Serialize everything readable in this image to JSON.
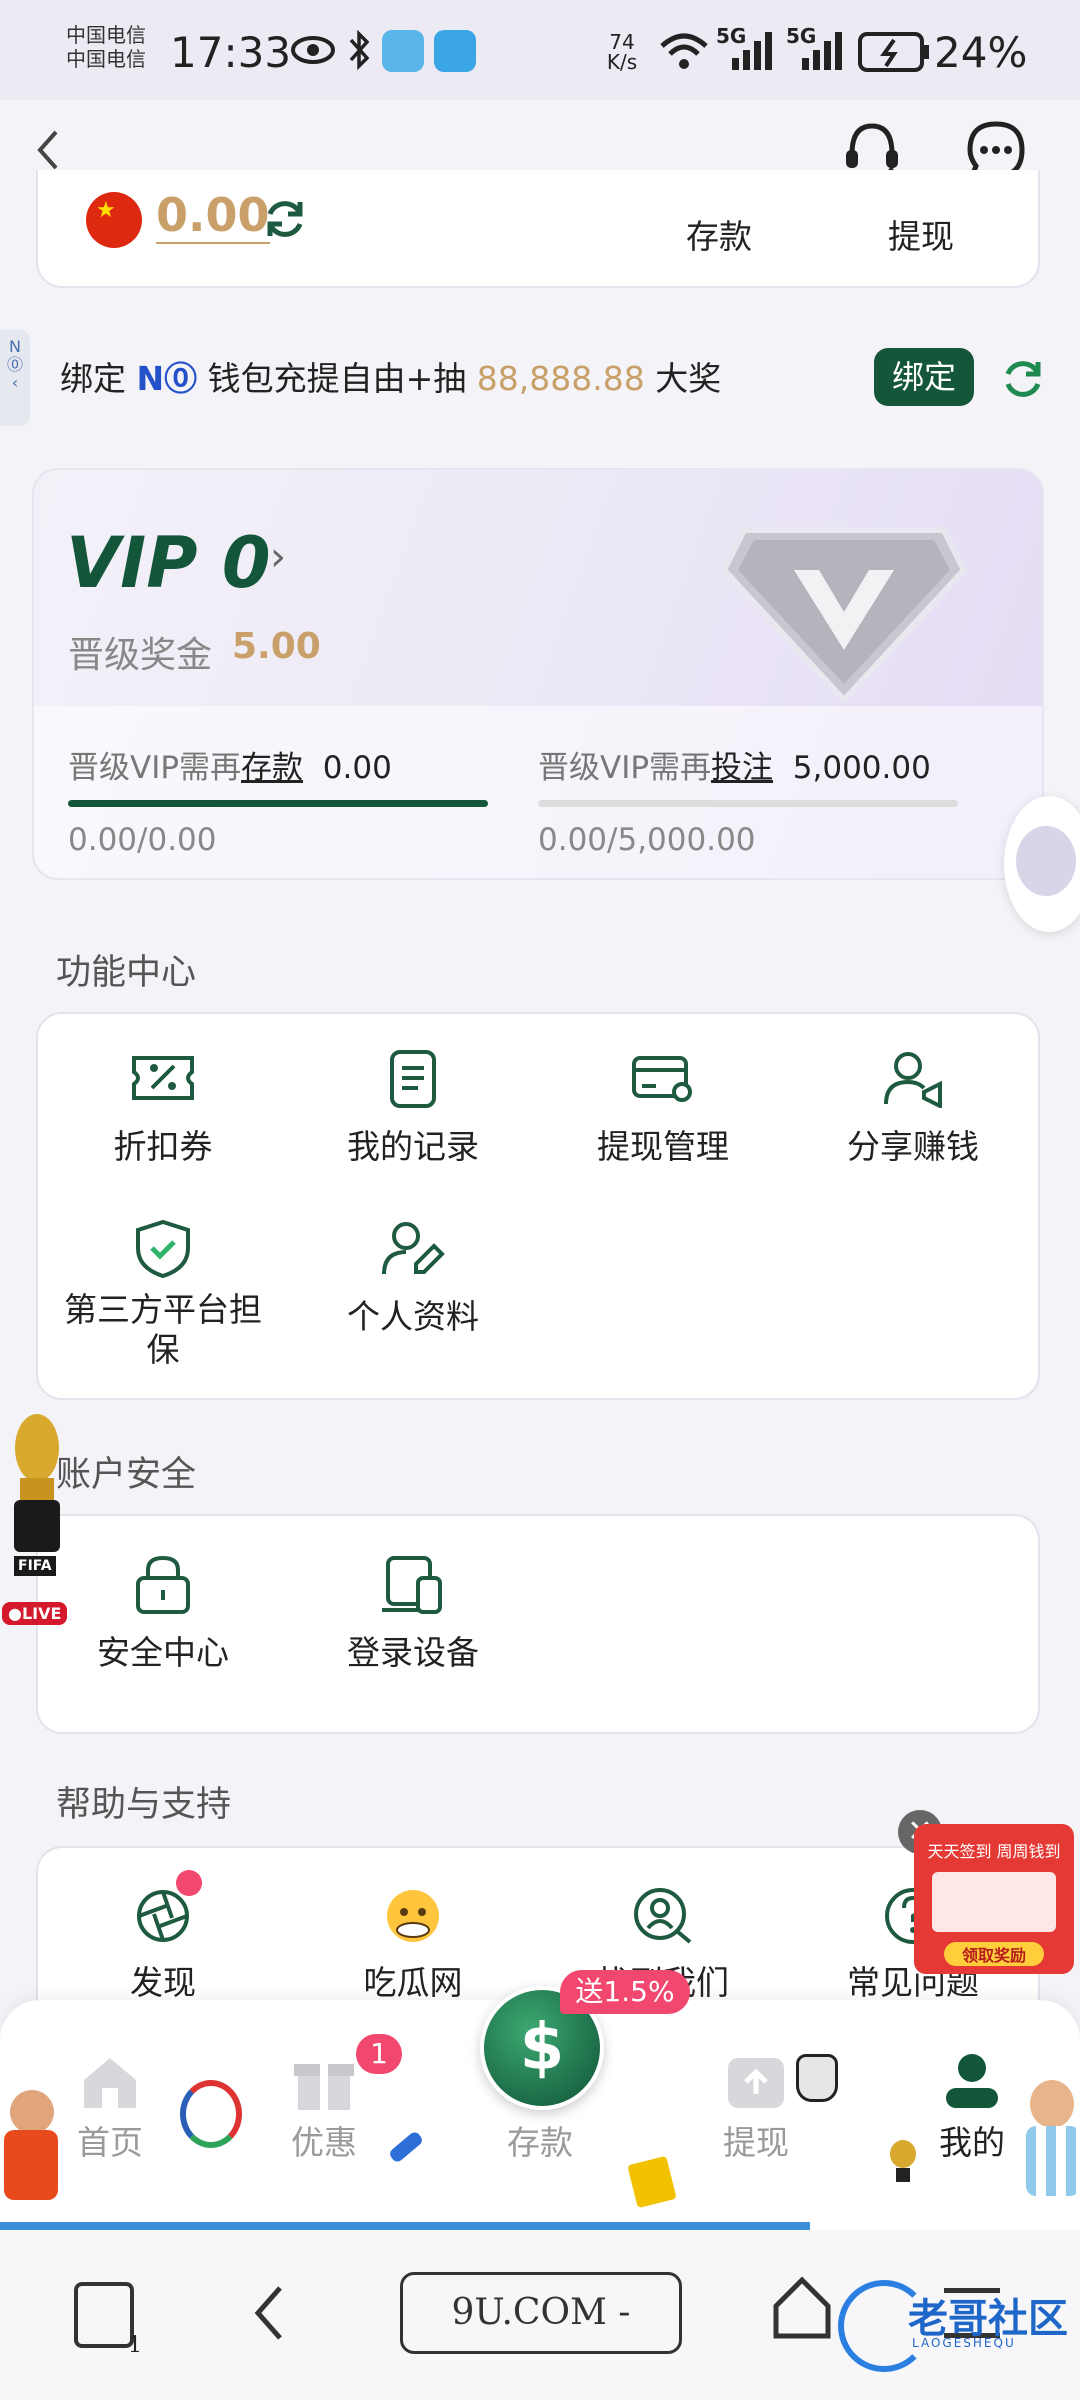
{
  "status": {
    "carrier1": "中国电信",
    "carrier2": "中国电信",
    "time": "17:33",
    "speed_value": "74",
    "speed_unit": "K/s",
    "net1": "5G",
    "net2": "5G",
    "battery": "24%"
  },
  "wallet": {
    "balance": "0.00",
    "deposit": "存款",
    "withdraw": "提现"
  },
  "promo": {
    "text1": "绑定",
    "brand": "N⓪",
    "text2": "钱包充提自由+抽",
    "amount": "88,888.88",
    "text3": "大奖",
    "bind_button": "绑定"
  },
  "vip": {
    "level": "VIP 0",
    "bonus_label": "晋级奖金",
    "bonus_value": "5.00",
    "deposit_need_prefix": "晋级VIP需再",
    "deposit_need_word": "存款",
    "deposit_need_value": "0.00",
    "deposit_progress": "0.00/0.00",
    "deposit_fill": 1.0,
    "bet_need_prefix": "晋级VIP需再",
    "bet_need_word": "投注",
    "bet_need_value": "5,000.00",
    "bet_progress": "0.00/5,000.00",
    "bet_fill": 0.0
  },
  "functions": {
    "title": "功能中心",
    "items": [
      {
        "label": "折扣券",
        "icon": "coupon-icon"
      },
      {
        "label": "我的记录",
        "icon": "record-icon"
      },
      {
        "label": "提现管理",
        "icon": "card-icon"
      },
      {
        "label": "分享赚钱",
        "icon": "share-icon"
      },
      {
        "label": "第三方平台担保",
        "icon": "shield-check-icon"
      },
      {
        "label": "个人资料",
        "icon": "profile-edit-icon"
      }
    ]
  },
  "security": {
    "title": "账户安全",
    "items": [
      {
        "label": "安全中心",
        "icon": "lock-icon"
      },
      {
        "label": "登录设备",
        "icon": "devices-icon"
      }
    ]
  },
  "help": {
    "title": "帮助与支持",
    "items": [
      {
        "label": "发现",
        "icon": "aperture-icon"
      },
      {
        "label": "吃瓜网",
        "icon": "emoji-icon"
      },
      {
        "label": "找到我们",
        "icon": "search-user-icon"
      },
      {
        "label": "常见问题",
        "icon": "question-icon"
      }
    ]
  },
  "float": {
    "live": "●LIVE",
    "fifa": "FIFA",
    "signin": "天天签到 周周钱到",
    "signin_btn": "领取奖励"
  },
  "tabs": {
    "home": "首页",
    "promo": "优惠",
    "promo_badge": "1",
    "deposit": "存款",
    "deposit_badge": "送1.5%",
    "withdraw": "提现",
    "mine": "我的"
  },
  "navbar": {
    "url": "9U.COM -",
    "tabs_count": "1",
    "watermark": "老哥社区",
    "watermark_sub": "LAOGESHEQU"
  },
  "colors": {
    "accent": "#13563a",
    "gold": "#c9a069",
    "background": "#f4f3f7"
  }
}
